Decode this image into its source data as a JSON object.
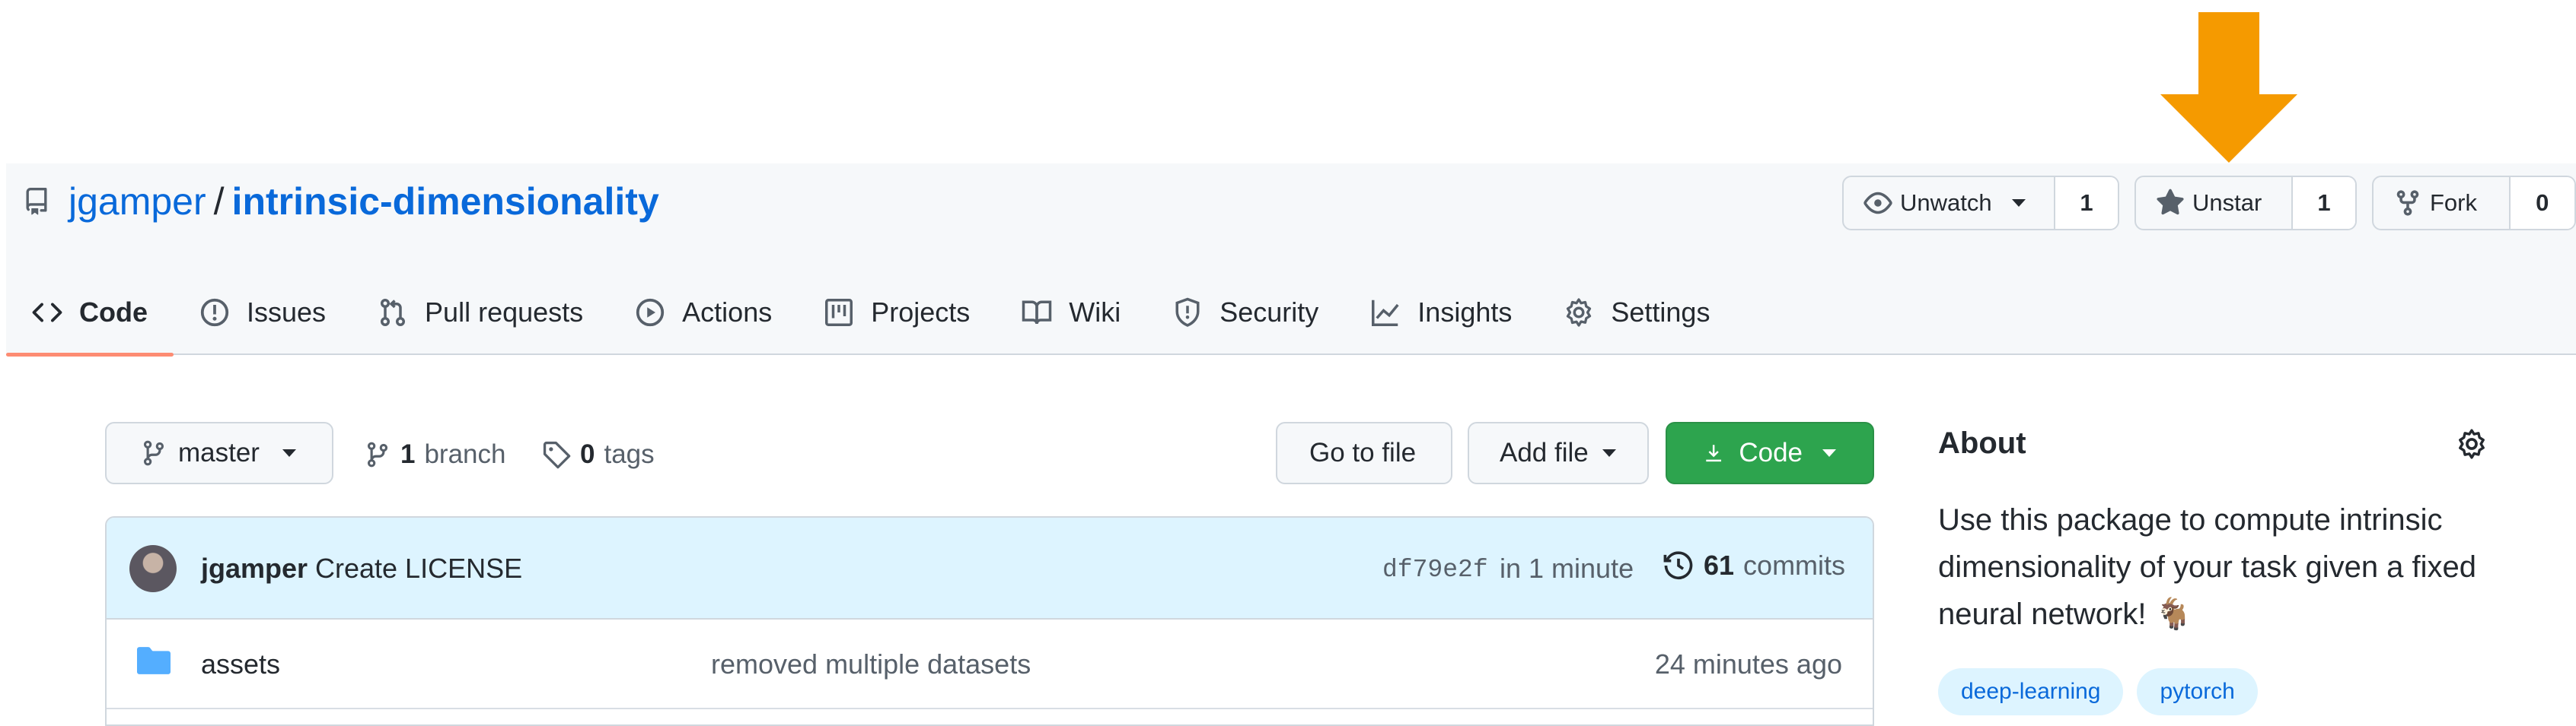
{
  "repo": {
    "owner": "jgamper",
    "separator": "/",
    "name": "intrinsic-dimensionality"
  },
  "header_actions": {
    "watch": {
      "label": "Unwatch",
      "count": "1"
    },
    "star": {
      "label": "Unstar",
      "count": "1"
    },
    "fork": {
      "label": "Fork",
      "count": "0"
    }
  },
  "tabs": [
    {
      "label": "Code",
      "icon": "code-icon",
      "active": true
    },
    {
      "label": "Issues",
      "icon": "issue-icon"
    },
    {
      "label": "Pull requests",
      "icon": "pull-request-icon"
    },
    {
      "label": "Actions",
      "icon": "play-icon"
    },
    {
      "label": "Projects",
      "icon": "project-icon"
    },
    {
      "label": "Wiki",
      "icon": "book-icon"
    },
    {
      "label": "Security",
      "icon": "shield-icon"
    },
    {
      "label": "Insights",
      "icon": "graph-icon"
    },
    {
      "label": "Settings",
      "icon": "gear-icon"
    }
  ],
  "toolbar": {
    "branch_selector": "master",
    "branch_count": "1",
    "branch_word": "branch",
    "tag_count": "0",
    "tag_word": "tags",
    "go_to_file": "Go to file",
    "add_file": "Add file",
    "code": "Code"
  },
  "latest_commit": {
    "author": "jgamper",
    "message": "Create LICENSE",
    "sha": "df79e2f",
    "time": "in 1 minute",
    "commit_count": "61",
    "commit_word": "commits"
  },
  "files": [
    {
      "name": "assets",
      "type": "folder",
      "message": "removed multiple datasets",
      "age": "24 minutes ago"
    }
  ],
  "about": {
    "title": "About",
    "description": "Use this package to compute intrinsic dimensionality of your task given a fixed neural network! 🐐",
    "topics": [
      "deep-learning",
      "pytorch"
    ]
  },
  "colors": {
    "arrow": "#f59a00",
    "link": "#0969da",
    "green_button": "#2da44e",
    "active_tab_underline": "#fd8c73"
  }
}
